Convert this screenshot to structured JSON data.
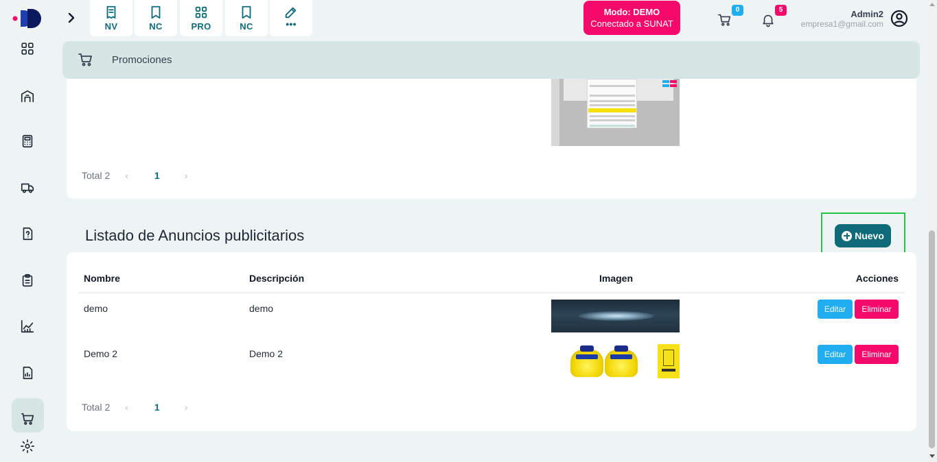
{
  "quick_actions": [
    {
      "label": "NV",
      "icon": "document-list-icon"
    },
    {
      "label": "NC",
      "icon": "document-icon"
    },
    {
      "label": "PRO",
      "icon": "grid-icon"
    },
    {
      "label": "NC",
      "icon": "document-icon"
    },
    {
      "label": "•••",
      "icon": "edit-icon"
    }
  ],
  "mode_badge": {
    "line1": "Modo: DEMO",
    "line2": "Conectado a SUNAT"
  },
  "cart_count": "0",
  "notifications_count": "5",
  "user": {
    "name": "Admin2",
    "email": "empresa1@gmail.com"
  },
  "breadcrumb": {
    "label": "Promociones"
  },
  "promotions_pager": {
    "total": "Total 2",
    "page": "1"
  },
  "ads": {
    "title": "Listado de Anuncios publicitarios",
    "new_button": "Nuevo",
    "columns": {
      "name": "Nombre",
      "description": "Descripción",
      "image": "Imagen",
      "actions": "Acciones"
    },
    "rows": [
      {
        "name": "demo",
        "description": "demo",
        "edit": "Editar",
        "delete": "Eliminar"
      },
      {
        "name": "Demo 2",
        "description": "Demo 2",
        "edit": "Editar",
        "delete": "Eliminar"
      }
    ],
    "pager": {
      "total": "Total 2",
      "page": "1"
    }
  },
  "colors": {
    "accent": "#0f6b7a",
    "demo_badge": "#f50a6b",
    "edit": "#20aef0",
    "delete": "#f50a6b",
    "cart_counter": "#20aef0",
    "notif_counter": "#f50a6b",
    "highlight": "#22c545"
  }
}
